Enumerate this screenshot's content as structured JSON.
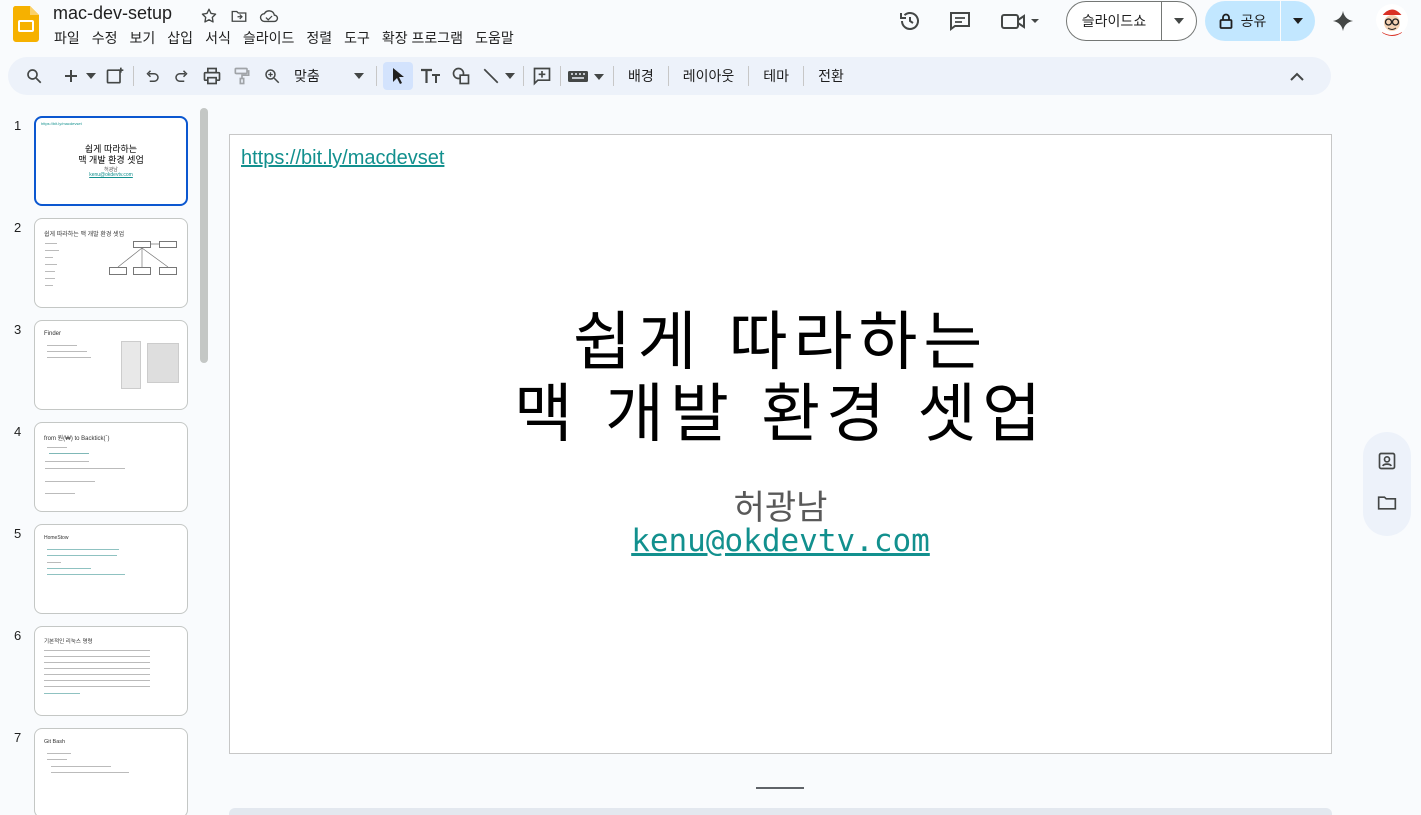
{
  "header": {
    "title": "mac-dev-setup",
    "menu": [
      "파일",
      "수정",
      "보기",
      "삽입",
      "서식",
      "슬라이드",
      "정렬",
      "도구",
      "확장 프로그램",
      "도움말"
    ],
    "slideshow_label": "슬라이드쇼",
    "share_label": "공유"
  },
  "toolbar": {
    "zoom_label": "맞춤",
    "background_label": "배경",
    "layout_label": "레이아웃",
    "theme_label": "테마",
    "transition_label": "전환"
  },
  "filmstrip": {
    "slides": [
      {
        "num": "1",
        "lines": [
          "쉽게 따라하는",
          "맥 개발 환경 셋업",
          "허광남",
          "kenu@okdevtv.com"
        ],
        "link": "https://bit.ly/macdevset"
      },
      {
        "num": "2",
        "title": "쉽게 따라하는 맥 개발 환경 셋업"
      },
      {
        "num": "3",
        "title": "Finder"
      },
      {
        "num": "4",
        "title": "from 원(₩) to Backtick(`)"
      },
      {
        "num": "5",
        "title": "HomeStow"
      },
      {
        "num": "6",
        "title": "기본적인 리눅스 명령"
      },
      {
        "num": "7",
        "title": "Git Bash"
      }
    ]
  },
  "slide": {
    "link": "https://bit.ly/macdevset",
    "title_line1": "쉽게 따라하는",
    "title_line2": "맥 개발 환경 셋업",
    "author": "허광남",
    "email": "kenu@okdevtv.com"
  },
  "colors": {
    "accent": "#0b57d0",
    "share_bg": "#c2e7ff",
    "link": "#12908e",
    "toolbar_bg": "#edf2fa"
  }
}
